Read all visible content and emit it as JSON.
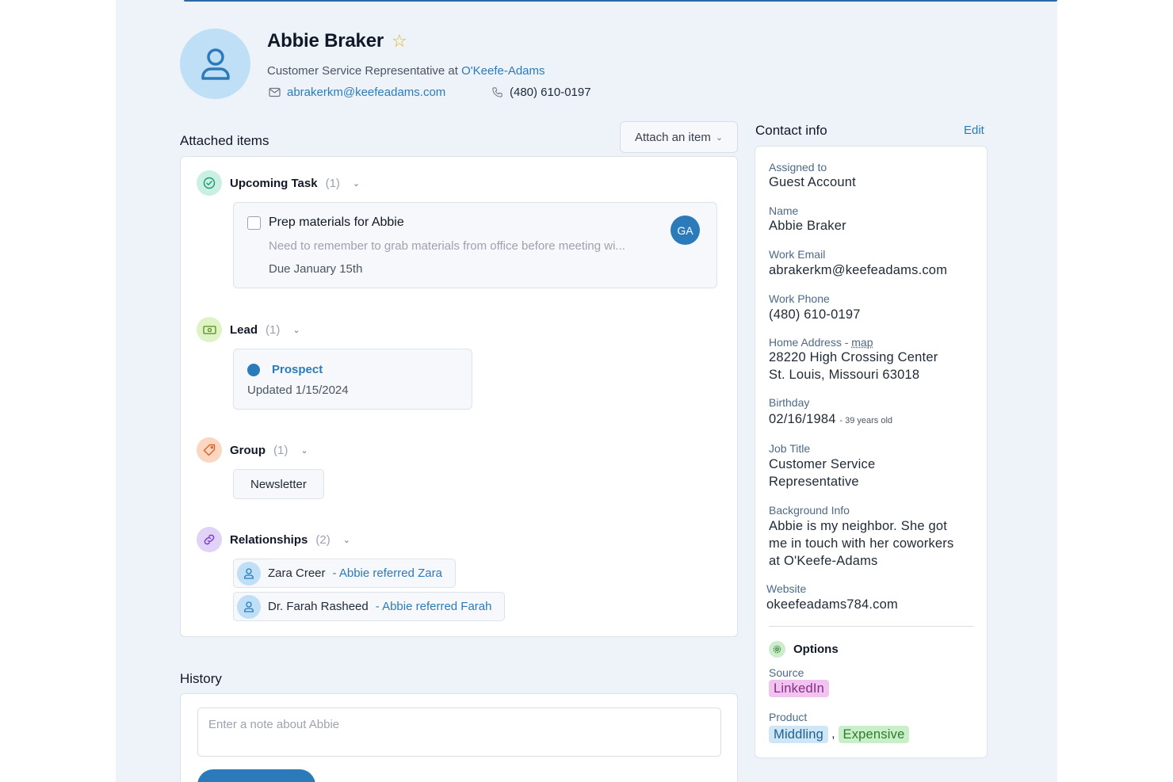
{
  "contact": {
    "name": "Abbie Braker",
    "title_prefix": "Customer Service Representative at",
    "company": "O'Keefe-Adams",
    "email": "abrakerkm@keefeadams.com",
    "phone": "(480) 610-0197"
  },
  "attached": {
    "title": "Attached items",
    "attach_button": "Attach an item",
    "task_group": {
      "label": "Upcoming Task",
      "count": "(1)"
    },
    "task": {
      "title": "Prep materials for Abbie",
      "description": "Need to remember to grab materials from office before meeting wi...",
      "due": "Due January 15th",
      "assignee_initials": "GA"
    },
    "lead_group": {
      "label": "Lead",
      "count": "(1)"
    },
    "lead": {
      "status": "Prospect",
      "updated": "Updated 1/15/2024"
    },
    "group_group": {
      "label": "Group",
      "count": "(1)"
    },
    "groups": [
      "Newsletter"
    ],
    "relationships_group": {
      "label": "Relationships",
      "count": "(2)"
    },
    "relationships": [
      {
        "name": "Zara Creer",
        "note": "- Abbie referred Zara"
      },
      {
        "name": "Dr. Farah Rasheed",
        "note": "- Abbie referred Farah"
      }
    ]
  },
  "history": {
    "title": "History",
    "placeholder": "Enter a note about Abbie"
  },
  "contact_info": {
    "title": "Contact info",
    "edit": "Edit",
    "assigned_label": "Assigned to",
    "assigned_value": "Guest Account",
    "name_label": "Name",
    "name_value": "Abbie Braker",
    "work_email_label": "Work Email",
    "work_email_value": "abrakerkm@keefeadams.com",
    "work_phone_label": "Work Phone",
    "work_phone_value": "(480) 610-0197",
    "home_address_label": "Home Address -",
    "map_link": "map",
    "address_line1": "28220 High Crossing Center",
    "address_line2": "St. Louis, Missouri 63018",
    "birthday_label": "Birthday",
    "birthday_value": "02/16/1984",
    "birthday_age": "- 39 years old",
    "job_title_label": "Job Title",
    "job_title_line1": "Customer Service",
    "job_title_line2": "Representative",
    "background_label": "Background Info",
    "background_line1": "Abbie is my neighbor. She got",
    "background_line2": "me in touch with her coworkers",
    "background_line3": "at O'Keefe-Adams",
    "website_label": "Website",
    "website_value": "okeefeadams784.com",
    "options_title": "Options",
    "source_label": "Source",
    "source_value": "LinkedIn",
    "product_label": "Product",
    "product_values": [
      "Middling",
      "Expensive"
    ],
    "product_separator": ","
  },
  "colors": {
    "accent": "#2b7bbb",
    "page_bg": "#eef3f9",
    "avatar_bg": "#bfdff7",
    "tag_linkedin": "#f0c4ee",
    "tag_middling": "#cfe6f7",
    "tag_expensive": "#c9efc9"
  }
}
